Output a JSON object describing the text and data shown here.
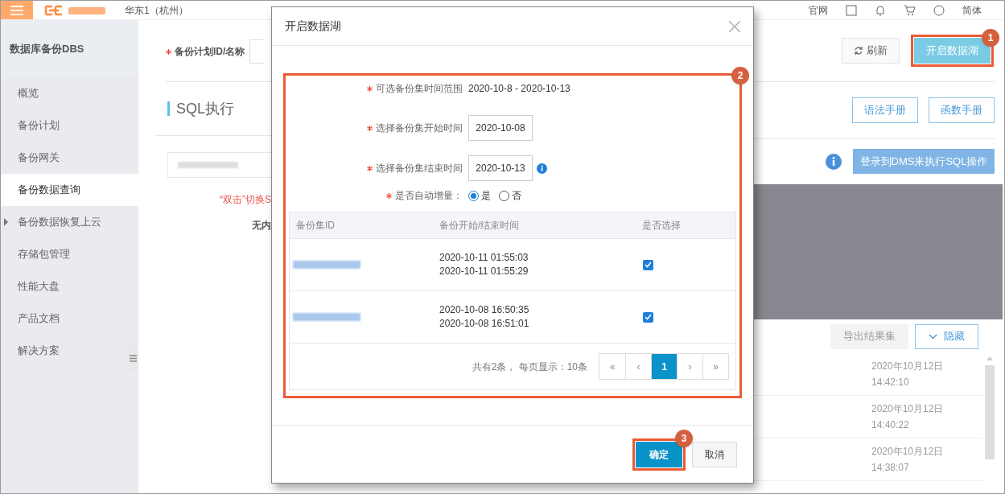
{
  "top_nav": {
    "region": "华东1（杭州）",
    "links": [
      "官网"
    ],
    "language": "简体"
  },
  "sidebar": {
    "title": "数据库备份DBS",
    "items": [
      {
        "label": "概览",
        "selected": false,
        "expandable": false
      },
      {
        "label": "备份计划",
        "selected": false,
        "expandable": false
      },
      {
        "label": "备份网关",
        "selected": false,
        "expandable": false
      },
      {
        "label": "备份数据查询",
        "selected": true,
        "expandable": false
      },
      {
        "label": "备份数据恢复上云",
        "selected": false,
        "expandable": true
      },
      {
        "label": "存储包管理",
        "selected": false,
        "expandable": false
      },
      {
        "label": "性能大盘",
        "selected": false,
        "expandable": false
      },
      {
        "label": "产品文档",
        "selected": false,
        "expandable": false
      },
      {
        "label": "解决方案",
        "selected": false,
        "expandable": false
      }
    ]
  },
  "query_form": {
    "label": "备份计划ID/名称",
    "required": true
  },
  "sql_panel": {
    "title": "SQL执行",
    "hint": "“双击”切换S",
    "empty_text": "无内"
  },
  "toolbar": {
    "refresh": "刷新",
    "open_lake": {
      "label": "开启数据湖",
      "badge": "1"
    }
  },
  "manual_buttons": [
    "语法手册",
    "函数手册"
  ],
  "dms_button": "登录到DMS来执行SQL操作",
  "result_actions": {
    "export": {
      "label": "导出结果集",
      "disabled": true
    },
    "hide": "隐藏"
  },
  "result_rows": [
    {
      "date": "2020年10月12日",
      "time": "14:42:10"
    },
    {
      "date": "2020年10月12日",
      "time": "14:40:22"
    },
    {
      "date": "2020年10月12日",
      "time": "14:38:07"
    }
  ],
  "dialog": {
    "title": "开启数据湖",
    "badge": "2",
    "fields": [
      {
        "kind": "text",
        "label": "可选备份集时间范围",
        "value": "2020-10-8 - 2020-10-13",
        "required": true
      },
      {
        "kind": "input",
        "label": "选择备份集开始时间",
        "value": "2020-10-08",
        "required": true,
        "info": false
      },
      {
        "kind": "input",
        "label": "选择备份集结束时间",
        "value": "2020-10-13",
        "required": true,
        "info": true
      },
      {
        "kind": "radio",
        "label": "是否自动增量：",
        "required": true,
        "options": [
          {
            "label": "是",
            "selected": true
          },
          {
            "label": "否",
            "selected": false
          }
        ]
      }
    ],
    "table": {
      "columns": [
        "备份集ID",
        "备份开始/结束时间",
        "是否选择"
      ],
      "rows": [
        {
          "start": "2020-10-11 01:55:03",
          "end": "2020-10-11 01:55:29",
          "checked": true
        },
        {
          "start": "2020-10-08 16:50:35",
          "end": "2020-10-08 16:51:01",
          "checked": true
        }
      ]
    },
    "pagination": {
      "summary": "共有2条， 每页显示：10条",
      "pages": [
        {
          "label": "«",
          "selected": false
        },
        {
          "label": "‹",
          "selected": false
        },
        {
          "label": "1",
          "selected": true
        },
        {
          "label": "›",
          "selected": false
        },
        {
          "label": "»",
          "selected": false
        }
      ]
    },
    "buttons": [
      {
        "label": "确定",
        "kind": "primary",
        "badge": "3"
      },
      {
        "label": "取消",
        "kind": "default"
      }
    ]
  }
}
